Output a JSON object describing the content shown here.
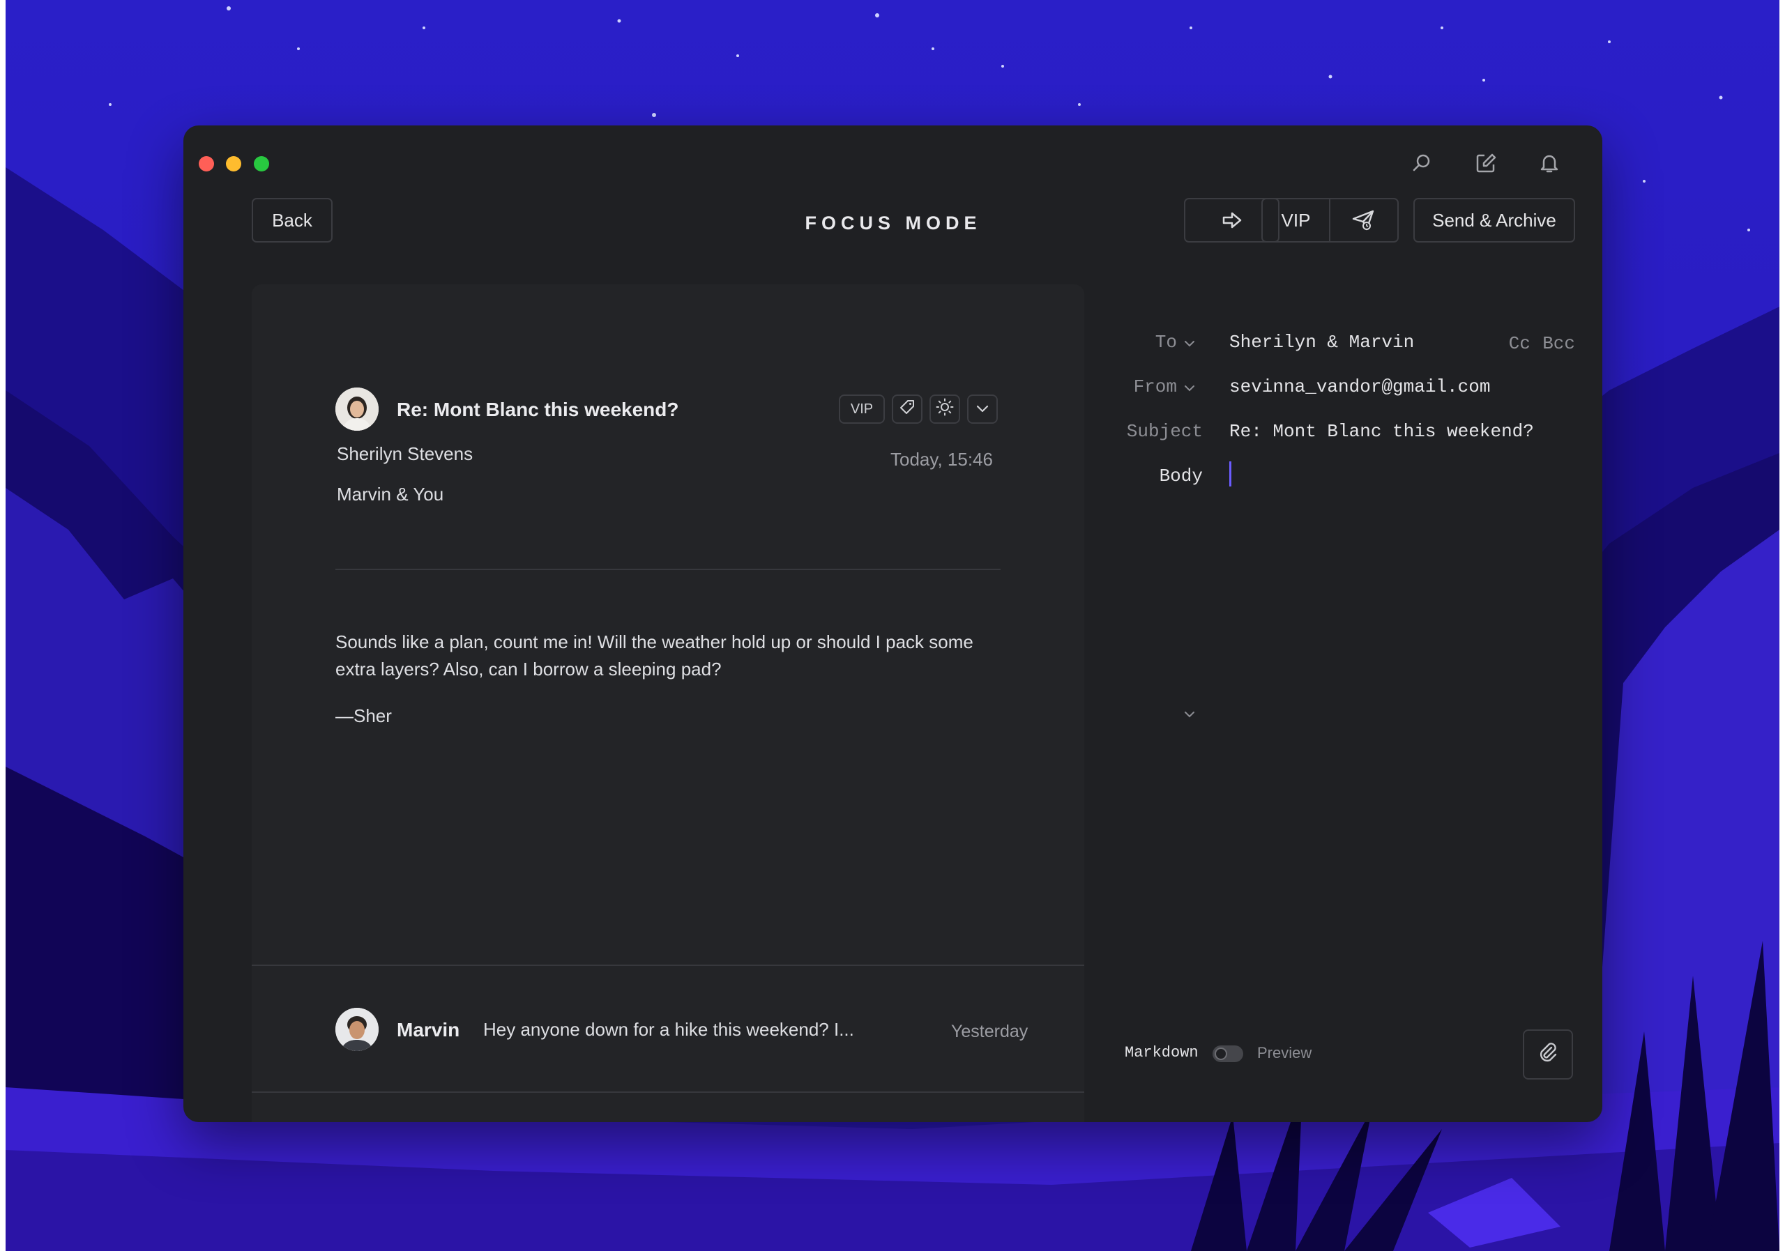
{
  "toolbar": {
    "back_label": "Back",
    "mode_title": "FOCUS MODE",
    "vip_label": "VIP",
    "send_archive_label": "Send & Archive",
    "icons": [
      "search-icon",
      "compose-icon",
      "bell-icon",
      "forward-icon",
      "send-later-icon"
    ]
  },
  "thread": {
    "subject": "Re: Mont Blanc this weekend?",
    "chips": {
      "vip": "VIP"
    },
    "from_name": "Sherilyn Stevens",
    "to_line": "Marvin & You",
    "timestamp": "Today, 15:46",
    "body": "Sounds like a plan, count me in! Will the weather hold up or should I pack some extra layers? Also, can I borrow a sleeping pad?",
    "signature": "—Sher",
    "previous": {
      "sender": "Marvin",
      "snippet": "Hey anyone down for a hike this weekend? I...",
      "timestamp": "Yesterday"
    }
  },
  "compose": {
    "to_label": "To",
    "to_value": "Sherilyn & Marvin",
    "cc_label": "Cc",
    "bcc_label": "Bcc",
    "from_label": "From",
    "from_value": "sevinna_vandor@gmail.com",
    "subject_label": "Subject",
    "subject_value": "Re: Mont Blanc this weekend?",
    "body_label": "Body",
    "markdown_label": "Markdown",
    "preview_label": "Preview",
    "markdown_enabled": false
  },
  "colors": {
    "window_bg": "#1f2023",
    "panel_bg": "#232427",
    "accent_caret": "#6b5cff",
    "traffic_red": "#ff5f57",
    "traffic_yellow": "#febc2e",
    "traffic_green": "#28c840"
  }
}
